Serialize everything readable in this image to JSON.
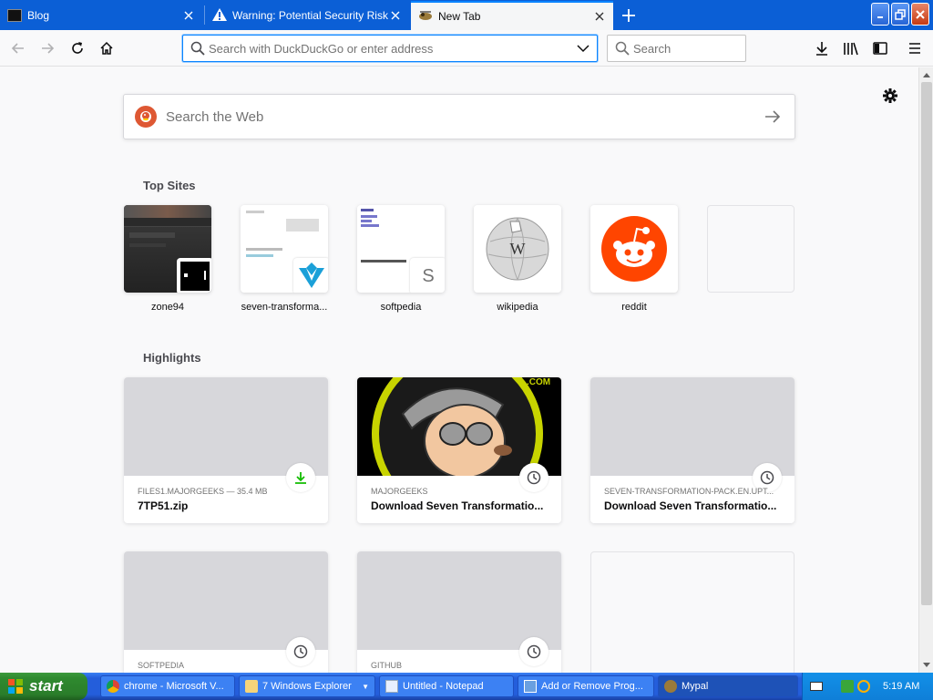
{
  "browser": {
    "tabs": [
      {
        "title": "Blog",
        "active": false
      },
      {
        "title": "Warning: Potential Security Risk A",
        "active": false
      },
      {
        "title": "New Tab",
        "active": true
      }
    ],
    "urlbar": {
      "placeholder": "Search with DuckDuckGo or enter address",
      "value": ""
    },
    "searchbar": {
      "placeholder": "Search",
      "value": ""
    }
  },
  "newtab": {
    "web_search_placeholder": "Search the Web",
    "top_sites_heading": "Top Sites",
    "top_sites": [
      {
        "label": "zone94"
      },
      {
        "label": "seven-transforma..."
      },
      {
        "label": "softpedia",
        "badge_letter": "S"
      },
      {
        "label": "wikipedia",
        "badge_letter": "W"
      },
      {
        "label": "reddit"
      },
      {
        "label": ""
      }
    ],
    "highlights_heading": "Highlights",
    "highlights": [
      {
        "source": "FILES1.MAJORGEEKS — 35.4 MB",
        "title": "7TP51.zip",
        "icon": "download-icon"
      },
      {
        "source": "MAJORGEEKS",
        "title": "Download Seven Transformatio...",
        "icon": "clock-icon"
      },
      {
        "source": "SEVEN-TRANSFORMATION-PACK.EN.UPT...",
        "title": "Download Seven Transformatio...",
        "icon": "clock-icon"
      },
      {
        "source": "SOFTPEDIA",
        "title": "",
        "icon": "clock-icon"
      },
      {
        "source": "GITHUB",
        "title": "",
        "icon": "clock-icon"
      }
    ]
  },
  "taskbar": {
    "start_label": "start",
    "tasks": [
      {
        "label": "chrome - Microsoft V..."
      },
      {
        "label": "7 Windows Explorer"
      },
      {
        "label": "Untitled - Notepad"
      },
      {
        "label": "Add or Remove Prog..."
      },
      {
        "label": "Mypal"
      }
    ],
    "clock": "5:19 AM"
  },
  "colors": {
    "titlebar_blue": "#0b5fd6",
    "accent_focus": "#0a84ff",
    "download_green": "#12bc00",
    "reddit_orange": "#ff4500",
    "ddg_orange": "#de5833",
    "xp_start_green": "#2f8a2f"
  }
}
